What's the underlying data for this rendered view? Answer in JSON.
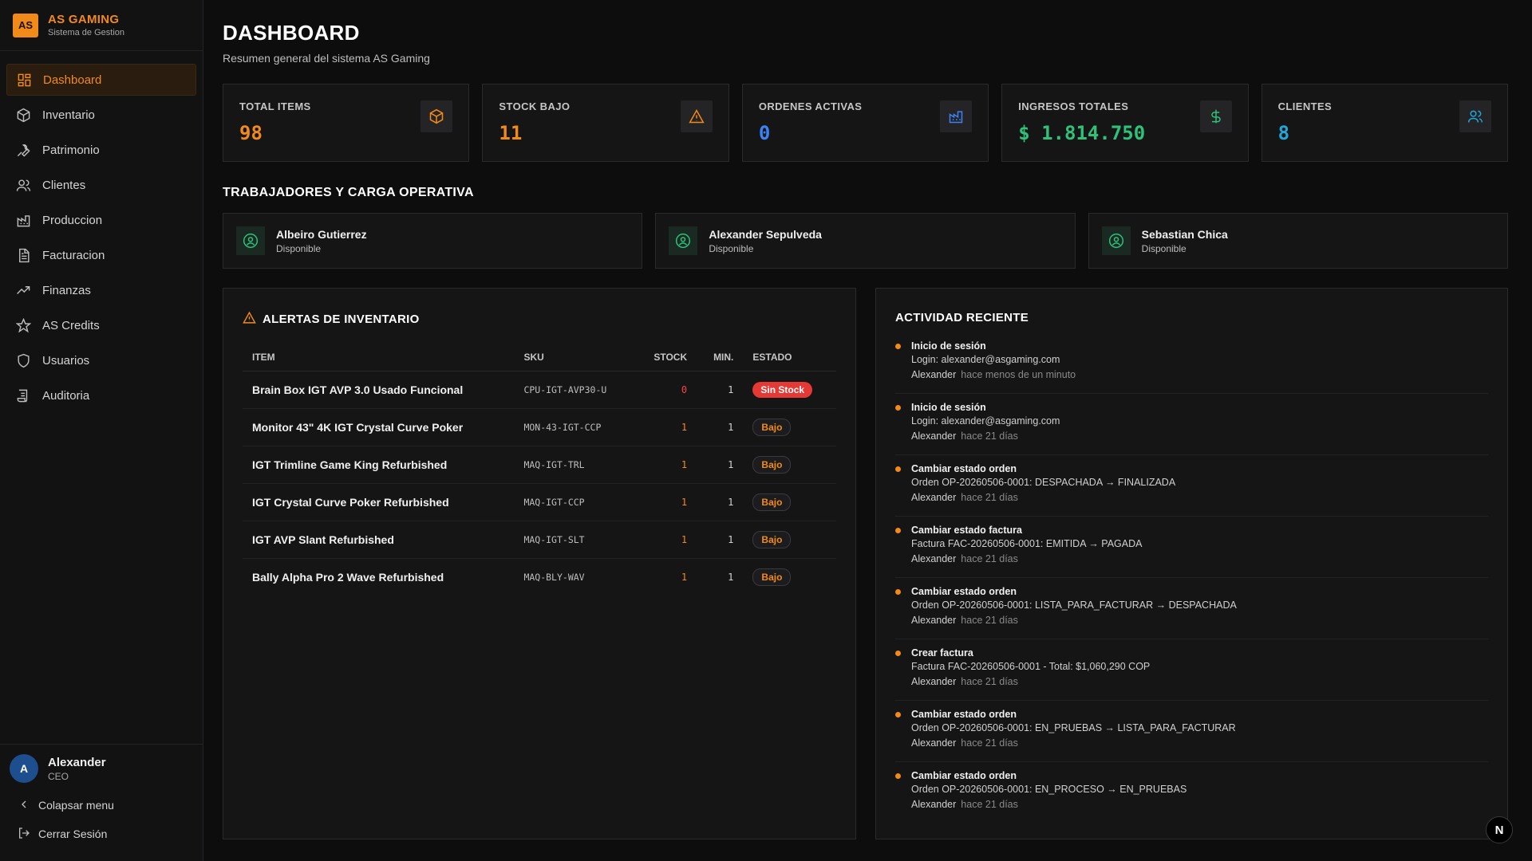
{
  "brand": {
    "logo": "AS",
    "name": "AS GAMING",
    "subtitle": "Sistema de Gestion"
  },
  "nav": [
    {
      "label": "Dashboard",
      "icon": "dashboard-icon",
      "active": true
    },
    {
      "label": "Inventario",
      "icon": "box-icon"
    },
    {
      "label": "Patrimonio",
      "icon": "wrench-icon"
    },
    {
      "label": "Clientes",
      "icon": "users-icon"
    },
    {
      "label": "Produccion",
      "icon": "factory-icon"
    },
    {
      "label": "Facturacion",
      "icon": "document-icon"
    },
    {
      "label": "Finanzas",
      "icon": "trend-icon"
    },
    {
      "label": "AS Credits",
      "icon": "star-icon"
    },
    {
      "label": "Usuarios",
      "icon": "shield-icon"
    },
    {
      "label": "Auditoria",
      "icon": "scroll-icon"
    }
  ],
  "user": {
    "initial": "A",
    "name": "Alexander",
    "role": "CEO"
  },
  "sidebar_bottom": {
    "collapse": "Colapsar menu",
    "logout": "Cerrar Sesión"
  },
  "header": {
    "title": "DASHBOARD",
    "subtitle": "Resumen general del sistema AS Gaming"
  },
  "stats": [
    {
      "label": "TOTAL ITEMS",
      "value": "98",
      "color": "#f28a1a",
      "icon": "box-icon"
    },
    {
      "label": "STOCK BAJO",
      "value": "11",
      "color": "#f28a1a",
      "icon": "warning-icon"
    },
    {
      "label": "ORDENES ACTIVAS",
      "value": "0",
      "color": "#3b82f6",
      "icon": "factory-icon"
    },
    {
      "label": "INGRESOS TOTALES",
      "value": "$ 1.814.750",
      "color": "#2fc07a",
      "icon": "dollar-icon"
    },
    {
      "label": "CLIENTES",
      "value": "8",
      "color": "#22a6d8",
      "icon": "users-icon"
    }
  ],
  "workers_title": "TRABAJADORES Y CARGA OPERATIVA",
  "workers": [
    {
      "name": "Albeiro Gutierrez",
      "status": "Disponible"
    },
    {
      "name": "Alexander Sepulveda",
      "status": "Disponible"
    },
    {
      "name": "Sebastian Chica",
      "status": "Disponible"
    }
  ],
  "alerts": {
    "title": "ALERTAS DE INVENTARIO",
    "columns": [
      "ITEM",
      "SKU",
      "STOCK",
      "MIN.",
      "ESTADO"
    ],
    "rows": [
      {
        "item": "Brain Box IGT AVP 3.0 Usado Funcional",
        "sku": "CPU-IGT-AVP30-U",
        "stock": "0",
        "min": "1",
        "estado": "Sin Stock"
      },
      {
        "item": "Monitor 43\" 4K IGT Crystal Curve Poker",
        "sku": "MON-43-IGT-CCP",
        "stock": "1",
        "min": "1",
        "estado": "Bajo"
      },
      {
        "item": "IGT Trimline Game King Refurbished",
        "sku": "MAQ-IGT-TRL",
        "stock": "1",
        "min": "1",
        "estado": "Bajo"
      },
      {
        "item": "IGT Crystal Curve Poker Refurbished",
        "sku": "MAQ-IGT-CCP",
        "stock": "1",
        "min": "1",
        "estado": "Bajo"
      },
      {
        "item": "IGT AVP Slant Refurbished",
        "sku": "MAQ-IGT-SLT",
        "stock": "1",
        "min": "1",
        "estado": "Bajo"
      },
      {
        "item": "Bally Alpha Pro 2 Wave Refurbished",
        "sku": "MAQ-BLY-WAV",
        "stock": "1",
        "min": "1",
        "estado": "Bajo"
      }
    ]
  },
  "activity": {
    "title": "ACTIVIDAD RECIENTE",
    "items": [
      {
        "title": "Inicio de sesión",
        "desc": "Login: alexander@asgaming.com",
        "user": "Alexander",
        "time": "hace menos de un minuto"
      },
      {
        "title": "Inicio de sesión",
        "desc": "Login: alexander@asgaming.com",
        "user": "Alexander",
        "time": "hace 21 días"
      },
      {
        "title": "Cambiar estado orden",
        "desc": "Orden OP-20260506-0001: DESPACHADA → FINALIZADA",
        "user": "Alexander",
        "time": "hace 21 días"
      },
      {
        "title": "Cambiar estado factura",
        "desc": "Factura FAC-20260506-0001: EMITIDA → PAGADA",
        "user": "Alexander",
        "time": "hace 21 días"
      },
      {
        "title": "Cambiar estado orden",
        "desc": "Orden OP-20260506-0001: LISTA_PARA_FACTURAR → DESPACHADA",
        "user": "Alexander",
        "time": "hace 21 días"
      },
      {
        "title": "Crear factura",
        "desc": "Factura FAC-20260506-0001 - Total: $1,060,290 COP",
        "user": "Alexander",
        "time": "hace 21 días"
      },
      {
        "title": "Cambiar estado orden",
        "desc": "Orden OP-20260506-0001: EN_PRUEBAS → LISTA_PARA_FACTURAR",
        "user": "Alexander",
        "time": "hace 21 días"
      },
      {
        "title": "Cambiar estado orden",
        "desc": "Orden OP-20260506-0001: EN_PROCESO → EN_PRUEBAS",
        "user": "Alexander",
        "time": "hace 21 días"
      }
    ]
  },
  "corner_badge": "N"
}
